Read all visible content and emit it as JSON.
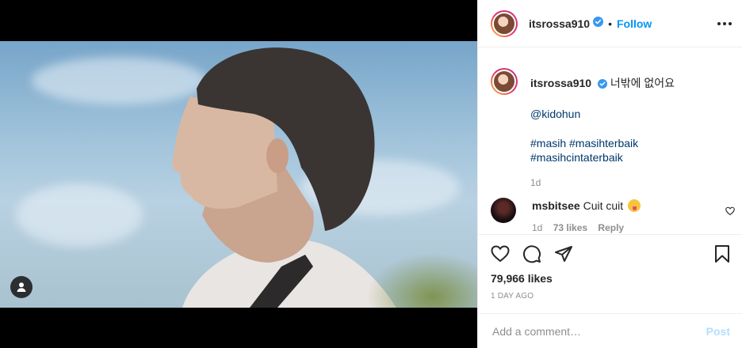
{
  "header": {
    "username": "itsrossa910",
    "separator": "•",
    "follow_label": "Follow"
  },
  "caption": {
    "username": "itsrossa910",
    "text": "너밖에 없어요",
    "mention": "@kidohun",
    "hashtags_line1": "#masih #masihterbaik",
    "hashtags_line2": "#masihcintaterbaik",
    "time": "1d"
  },
  "comment": {
    "username": "msbitsee",
    "text": "Cuit cuit",
    "emoji": "squinting-face-with-tongue",
    "time": "1d",
    "likes": "73 likes",
    "reply_label": "Reply"
  },
  "stats": {
    "likes": "79,966 likes",
    "posted": "1 DAY AGO"
  },
  "add_comment": {
    "placeholder": "Add a comment…",
    "post_label": "Post"
  },
  "colors": {
    "accent": "#0095f6",
    "text": "#262626",
    "muted": "#8e8e8e",
    "hashtag": "#00376b",
    "post_disabled": "#b2dffc"
  }
}
